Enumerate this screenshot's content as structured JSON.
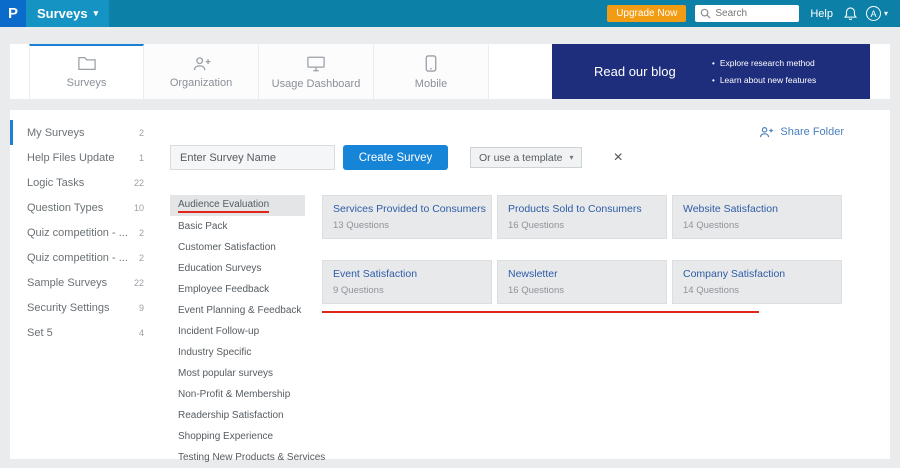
{
  "topbar": {
    "logo_letter": "P",
    "app_menu_label": "Surveys",
    "upgrade_label": "Upgrade Now",
    "search_placeholder": "Search",
    "help_label": "Help",
    "avatar_initial": "A"
  },
  "tabs": [
    {
      "label": "Surveys",
      "active": true
    },
    {
      "label": "Organization",
      "active": false
    },
    {
      "label": "Usage Dashboard",
      "active": false
    },
    {
      "label": "Mobile",
      "active": false
    }
  ],
  "blog_banner": {
    "title": "Read our blog",
    "bullets": [
      "Explore research method",
      "Learn about new features"
    ]
  },
  "sidebar": {
    "items": [
      {
        "label": "My Surveys",
        "count": "2",
        "active": true
      },
      {
        "label": "Help Files Update",
        "count": "1"
      },
      {
        "label": "Logic Tasks",
        "count": "22"
      },
      {
        "label": "Question Types",
        "count": "10"
      },
      {
        "label": "Quiz competition - ...",
        "count": "2"
      },
      {
        "label": "Quiz competition - ...",
        "count": "2"
      },
      {
        "label": "Sample Surveys",
        "count": "22"
      },
      {
        "label": "Security Settings",
        "count": "9"
      },
      {
        "label": "Set 5",
        "count": "4"
      }
    ]
  },
  "actions": {
    "share_folder_label": "Share Folder",
    "survey_name_placeholder": "Enter Survey Name",
    "create_button_label": "Create Survey",
    "template_dropdown_label": "Or use a template"
  },
  "templates": {
    "selected_category": "Audience Evaluation",
    "categories": [
      "Audience Evaluation",
      "Basic Pack",
      "Customer Satisfaction",
      "Education Surveys",
      "Employee Feedback",
      "Event Planning & Feedback",
      "Incident Follow-up",
      "Industry Specific",
      "Most popular surveys",
      "Non-Profit & Membership",
      "Readership Satisfaction",
      "Shopping Experience",
      "Testing New Products & Services"
    ],
    "cards": [
      {
        "title": "Services Provided to Consumers",
        "questions": "13 Questions"
      },
      {
        "title": "Products Sold to Consumers",
        "questions": "16 Questions"
      },
      {
        "title": "Website Satisfaction",
        "questions": "14 Questions"
      },
      {
        "title": "Event Satisfaction",
        "questions": "9 Questions"
      },
      {
        "title": "Newsletter",
        "questions": "16 Questions"
      },
      {
        "title": "Company Satisfaction",
        "questions": "14 Questions"
      }
    ]
  },
  "colors": {
    "topbar_teal": "#0d80a8",
    "appmenu_blue": "#1593c3",
    "logo_blue": "#0b6bcb",
    "upgrade_orange": "#f29c13",
    "banner_navy": "#1e2e7d",
    "accent_blue": "#1685d8",
    "card_title_blue": "#2e5ca6",
    "annotation_red": "#e0251b"
  }
}
